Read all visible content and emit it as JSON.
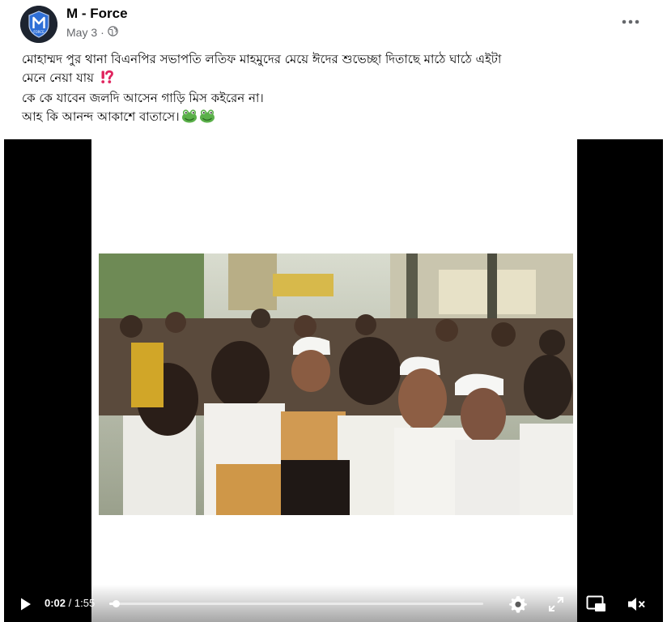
{
  "post": {
    "author": "M - Force",
    "date": "May 3",
    "dot": "·",
    "avatar_text": "FORCE",
    "caption_lines": [
      "মোহাম্মদ পুর থানা বিএনপির সভাপতি লতিফ মাহমুদের মেয়ে ঈদের শুভেচ্ছা দিতাছে মাঠে ঘাঠে এইটা",
      "মেনে নেয়া যায়",
      "কে কে যাবেন জলদি আসেন গাড়ি মিস কইরেন না।",
      "আহ কি আনন্দ আকাশে বাতাসে।"
    ]
  },
  "icons": {
    "globe": "globe-icon",
    "more": "more-dots-icon",
    "exclamation_question": "exclamation-question-icon",
    "frog": "frog-icon",
    "play": "play-icon",
    "settings": "gear-icon",
    "fullscreen": "expand-icon",
    "pip": "picture-in-picture-icon",
    "mute": "speaker-muted-icon"
  },
  "video": {
    "current_time": "0:02",
    "separator": "/",
    "duration": "1:55",
    "progress": 0.017
  },
  "colors": {
    "text_primary": "#050505",
    "text_secondary": "#65676b",
    "alert_red": "#e0245e",
    "video_bg": "#000000"
  }
}
